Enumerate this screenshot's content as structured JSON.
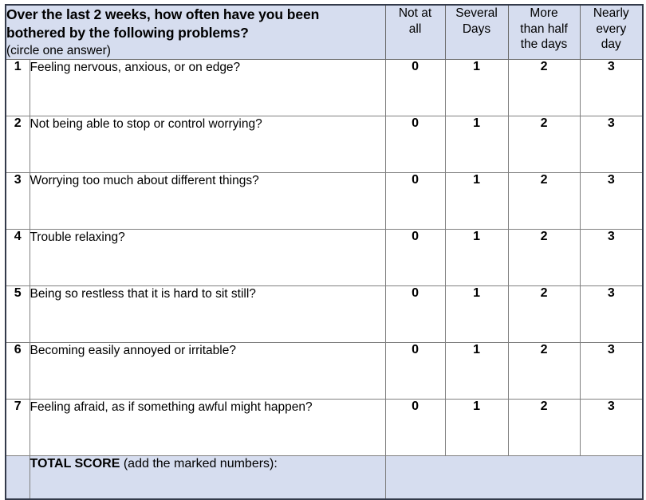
{
  "document": {
    "title": "GAD-7 Anxiety Questionnaire",
    "header_bg": "#d6ddef",
    "border_color": "#808080",
    "outer_border_color": "#333a4a"
  },
  "header": {
    "prompt_line1": "Over the last 2 weeks, how often have you been",
    "prompt_line2": "bothered by the following problems?",
    "prompt_sub": "(circle one answer)",
    "columns": [
      {
        "line1": "Not at",
        "line2": "all",
        "line3": ""
      },
      {
        "line1": "Several",
        "line2": "Days",
        "line3": ""
      },
      {
        "line1": "More",
        "line2": "than half",
        "line3": "the days"
      },
      {
        "line1": "Nearly",
        "line2": "every",
        "line3": "day"
      }
    ]
  },
  "questions": [
    {
      "num": "1",
      "text": "Feeling nervous, anxious, or on edge?",
      "scores": [
        "0",
        "1",
        "2",
        "3"
      ]
    },
    {
      "num": "2",
      "text": "Not being able to stop or control worrying?",
      "scores": [
        "0",
        "1",
        "2",
        "3"
      ]
    },
    {
      "num": "3",
      "text": "Worrying too much about different things?",
      "scores": [
        "0",
        "1",
        "2",
        "3"
      ]
    },
    {
      "num": "4",
      "text": "Trouble relaxing?",
      "scores": [
        "0",
        "1",
        "2",
        "3"
      ]
    },
    {
      "num": "5",
      "text": "Being so restless that it is hard to sit still?",
      "scores": [
        "0",
        "1",
        "2",
        "3"
      ]
    },
    {
      "num": "6",
      "text": "Becoming easily annoyed or irritable?",
      "scores": [
        "0",
        "1",
        "2",
        "3"
      ]
    },
    {
      "num": "7",
      "text": "Feeling afraid, as if something awful might happen?",
      "scores": [
        "0",
        "1",
        "2",
        "3"
      ]
    }
  ],
  "total": {
    "label_strong": "TOTAL SCORE",
    "label_plain": " (add the marked numbers):",
    "value": ""
  }
}
